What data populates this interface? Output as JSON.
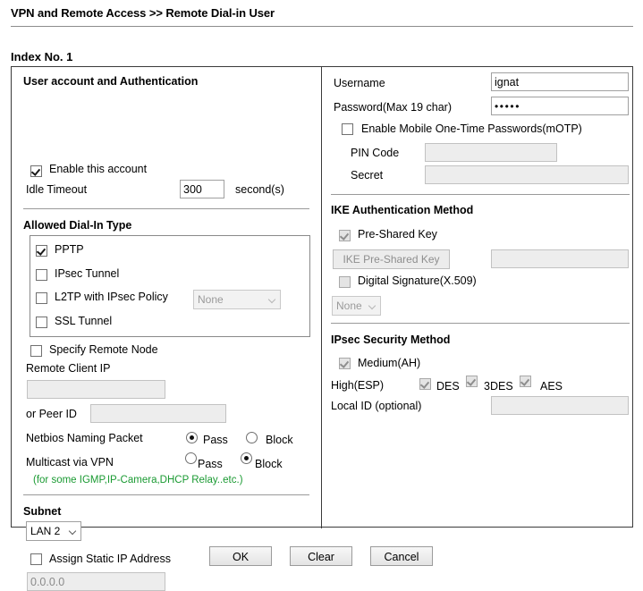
{
  "header": {
    "breadcrumb": "VPN and Remote Access >> Remote Dial-in User",
    "index_label": "Index No. 1"
  },
  "left": {
    "account_section": {
      "title": "User account and Authentication",
      "enable_account_label": "Enable this account",
      "enable_account_checked": true,
      "idle_timeout_label": "Idle Timeout",
      "idle_timeout_value": "300",
      "idle_timeout_unit": "second(s)"
    },
    "dialin_section": {
      "title": "Allowed Dial-In Type",
      "items": [
        {
          "label": "PPTP",
          "checked": true
        },
        {
          "label": "IPsec Tunnel",
          "checked": false
        },
        {
          "label": "L2TP with IPsec Policy",
          "checked": false
        },
        {
          "label": "SSL Tunnel",
          "checked": false
        }
      ],
      "l2tp_policy_value": "None",
      "l2tp_policy_disabled": true
    },
    "remote_node": {
      "specify_label": "Specify Remote Node",
      "specify_checked": false,
      "remote_client_ip_label": "Remote Client IP",
      "remote_client_ip_value": "",
      "peer_id_label": "or Peer ID",
      "peer_id_value": "",
      "netbios_label": "Netbios Naming Packet",
      "netbios_pass_label": "Pass",
      "netbios_block_label": "Block",
      "netbios_selected": "Pass",
      "multicast_label": "Multicast via VPN",
      "multicast_pass_label": "Pass",
      "multicast_block_label": "Block",
      "multicast_selected": "Block",
      "multicast_hint": "(for some IGMP,IP-Camera,DHCP Relay..etc.)"
    },
    "subnet_section": {
      "title": "Subnet",
      "subnet_value": "LAN 2",
      "assign_static_label": "Assign Static IP Address",
      "assign_static_checked": false,
      "static_ip_value": "0.0.0.0"
    }
  },
  "right": {
    "credentials": {
      "username_label": "Username",
      "username_value": "ignat",
      "password_label": "Password(Max 19 char)",
      "password_value": "•••••",
      "motp_label": "Enable Mobile One-Time Passwords(mOTP)",
      "motp_checked": false,
      "pin_code_label": "PIN Code",
      "pin_code_value": "",
      "secret_label": "Secret",
      "secret_value": ""
    },
    "ike_section": {
      "title": "IKE Authentication Method",
      "psk_label": "Pre-Shared Key",
      "psk_checked": true,
      "psk_disabled": true,
      "psk_button_label": "IKE Pre-Shared Key",
      "psk_value": "",
      "digital_sig_label": "Digital Signature(X.509)",
      "digital_sig_checked": false,
      "digital_sig_select_value": "None"
    },
    "ipsec_section": {
      "title": "IPsec Security Method",
      "medium_label": "Medium(AH)",
      "medium_checked": true,
      "high_label": "High(ESP)",
      "des_label": "DES",
      "des_checked": true,
      "triple_des_label": "3DES",
      "triple_des_checked": true,
      "aes_label": "AES",
      "aes_checked": true,
      "local_id_label": "Local ID (optional)",
      "local_id_value": ""
    }
  },
  "footer": {
    "ok_label": "OK",
    "clear_label": "Clear",
    "cancel_label": "Cancel"
  }
}
